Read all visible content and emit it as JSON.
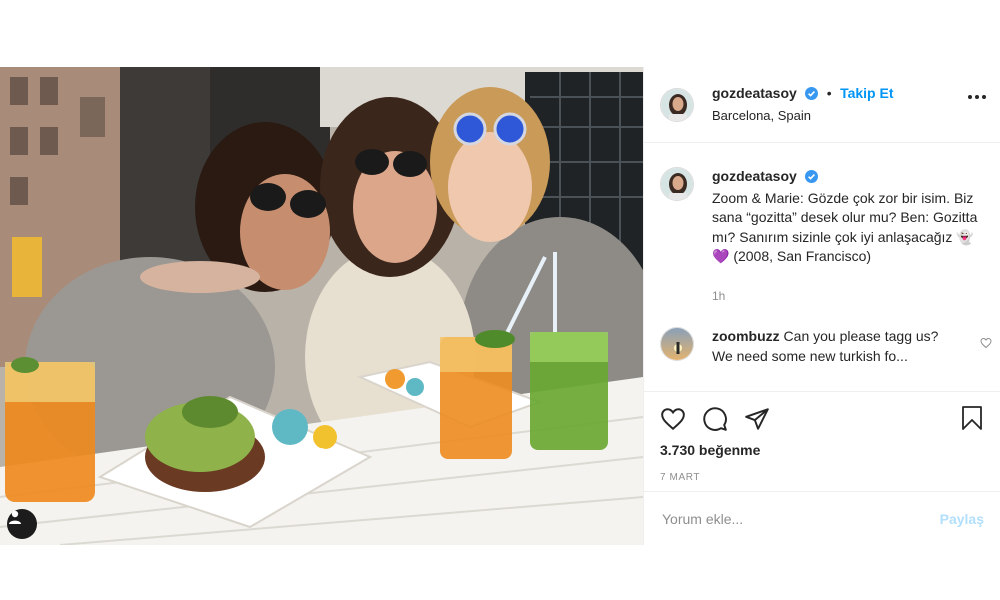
{
  "post": {
    "author": {
      "username": "gozdeatasoy",
      "verified": true,
      "follow_label": "Takip Et",
      "location": "Barcelona, Spain",
      "separator": "•"
    },
    "caption": {
      "username": "gozdeatasoy",
      "text": "Zoom & Marie: Gözde çok zor bir isim. Biz sana “gozitta” desek olur mu? Ben: Gozitta mı? Sanırım sizinle çok iyi anlaşacağız 👻 💜 (2008, San Francisco)",
      "time": "1h"
    },
    "comments": [
      {
        "username": "zoombuzz",
        "text": "Can you please tagg us? We need some new turkish fo..."
      }
    ],
    "likes": "3.730 beğenme",
    "date": "7 MART",
    "add_comment": {
      "placeholder": "Yorum ekle...",
      "post_label": "Paylaş"
    }
  },
  "icons": {
    "more": "more-options-icon",
    "like": "heart-icon",
    "comment": "comment-icon",
    "share": "share-icon",
    "save": "bookmark-icon",
    "verified": "verified-badge-icon",
    "user_tags": "user-tag-icon"
  },
  "colors": {
    "link_blue": "#0095f6",
    "verified_blue": "#3897f0",
    "muted": "#8e8e8e",
    "post_disabled": "#b2dffc"
  }
}
